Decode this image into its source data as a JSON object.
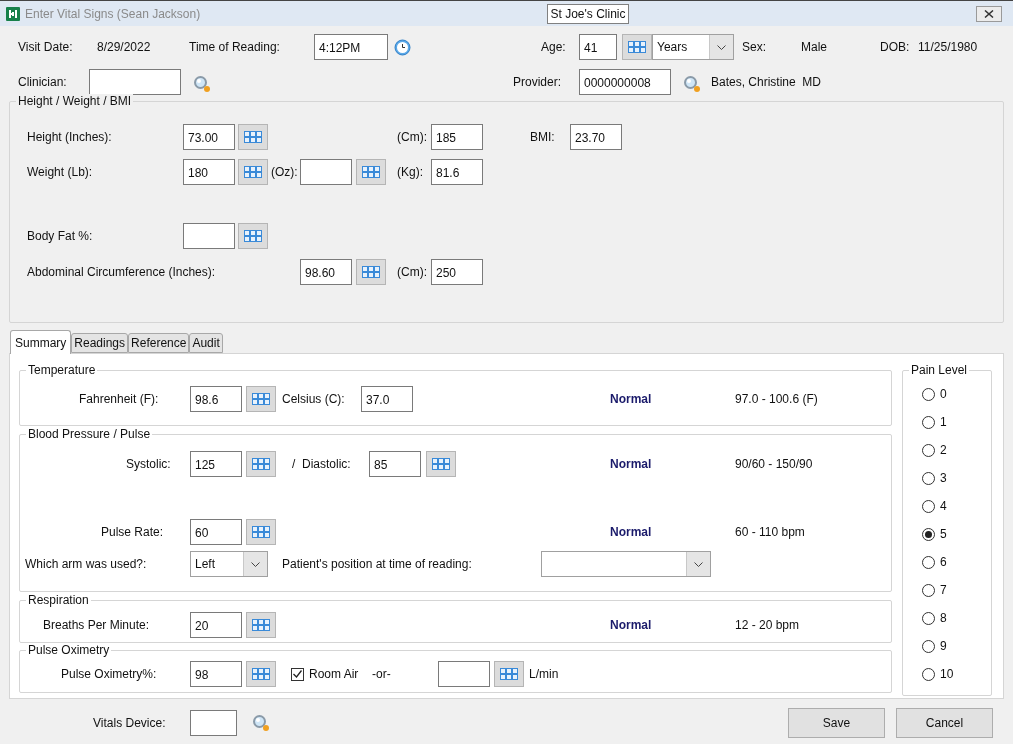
{
  "window": {
    "title": "Enter Vital Signs (Sean Jackson)",
    "clinic": "St Joe's Clinic"
  },
  "header": {
    "visit_date_label": "Visit Date:",
    "visit_date": "8/29/2022",
    "time_label": "Time of Reading:",
    "time": "4:12PM",
    "age_label": "Age:",
    "age": "41",
    "age_unit": "Years",
    "sex_label": "Sex:",
    "sex": "Male",
    "dob_label": "DOB:",
    "dob": "11/25/1980",
    "clinician_label": "Clinician:",
    "provider_label": "Provider:",
    "provider_id": "0000000008",
    "provider_name": "Bates, Christine  MD"
  },
  "height_weight_bmi": {
    "title": "Height / Weight / BMI",
    "height_in_label": "Height (Inches):",
    "height_in": "73.00",
    "height_cm_label": "(Cm):",
    "height_cm": "185",
    "bmi_label": "BMI:",
    "bmi": "23.70",
    "weight_lb_label": "Weight (Lb):",
    "weight_lb": "180",
    "weight_oz_label": "(Oz):",
    "weight_kg_label": "(Kg):",
    "weight_kg": "81.6",
    "body_fat_label": "Body Fat %:",
    "abdominal_in_label": "Abdominal Circumference (Inches):",
    "abdominal_in": "98.60",
    "abdominal_cm_label": "(Cm):",
    "abdominal_cm": "250"
  },
  "tabs": [
    {
      "label": "Summary",
      "selected": true
    },
    {
      "label": "Readings",
      "selected": false
    },
    {
      "label": "Reference",
      "selected": false
    },
    {
      "label": "Audit",
      "selected": false
    }
  ],
  "summary": {
    "temperature": {
      "title": "Temperature",
      "fahrenheit_label": "Fahrenheit (F):",
      "fahrenheit": "98.6",
      "celsius_label": "Celsius (C):",
      "celsius": "37.0",
      "status": "Normal",
      "range": "97.0 - 100.6 (F)"
    },
    "blood_pressure": {
      "title": "Blood Pressure / Pulse",
      "systolic_label": "Systolic:",
      "systolic": "125",
      "diastolic_label": "/  Diastolic:",
      "diastolic": "85",
      "bp_status": "Normal",
      "bp_range": "90/60 - 150/90",
      "pulse_label": "Pulse Rate:",
      "pulse": "60",
      "pulse_status": "Normal",
      "pulse_range": "60 - 110 bpm",
      "arm_label": "Which arm was used?:",
      "arm": "Left",
      "position_label": "Patient's position at time of reading:"
    },
    "respiration": {
      "title": "Respiration",
      "label": "Breaths Per Minute:",
      "value": "20",
      "status": "Normal",
      "range": "12 - 20 bpm"
    },
    "pulse_oximetry": {
      "title": "Pulse Oximetry",
      "label": "Pulse Oximetry%:",
      "value": "98",
      "room_air": {
        "label": "Room Air",
        "checked": true
      },
      "or": "-or-",
      "flow_unit": "L/min"
    }
  },
  "pain_level": {
    "title": "Pain Level",
    "options": [
      {
        "label": "0",
        "selected": false
      },
      {
        "label": "1",
        "selected": false
      },
      {
        "label": "2",
        "selected": false
      },
      {
        "label": "3",
        "selected": false
      },
      {
        "label": "4",
        "selected": false
      },
      {
        "label": "5",
        "selected": true
      },
      {
        "label": "6",
        "selected": false
      },
      {
        "label": "7",
        "selected": false
      },
      {
        "label": "8",
        "selected": false
      },
      {
        "label": "9",
        "selected": false
      },
      {
        "label": "10",
        "selected": false
      }
    ]
  },
  "footer": {
    "vitals_device_label": "Vitals Device:",
    "buttons": [
      "Save",
      "Cancel"
    ]
  }
}
